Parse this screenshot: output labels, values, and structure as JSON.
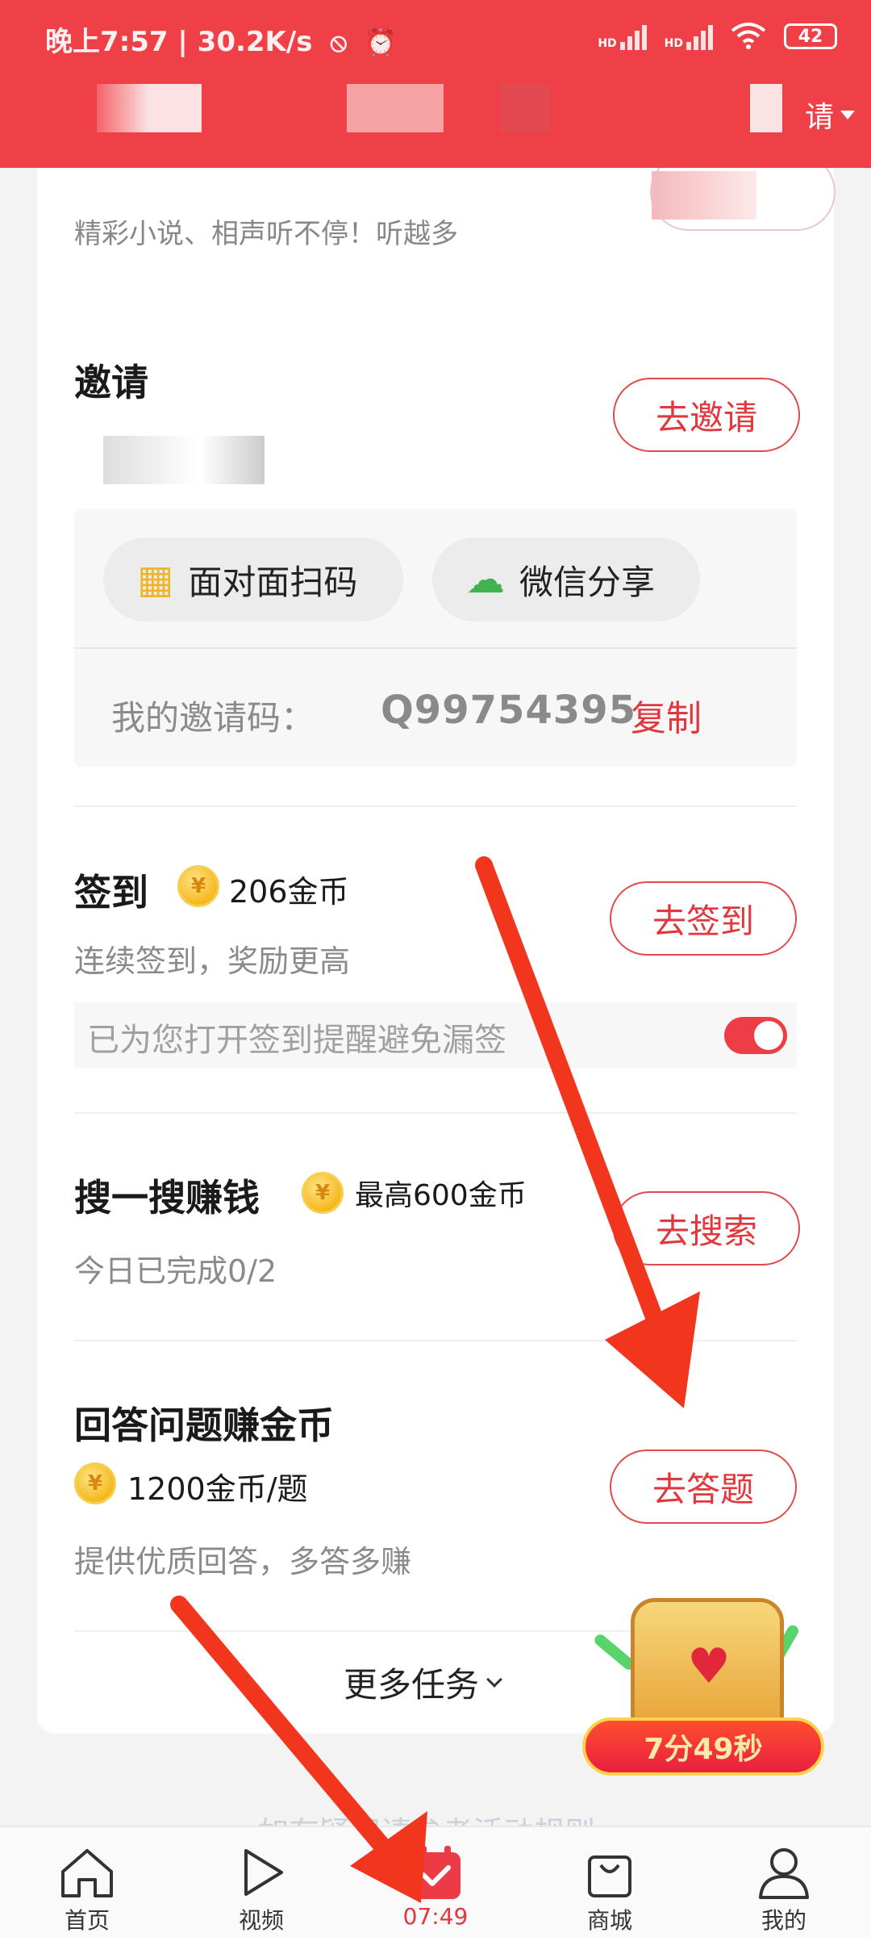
{
  "status_bar": {
    "left_text": "晚上7:57 | 30.2K/s",
    "signal_label_1": "HD",
    "signal_label_2": "HD",
    "battery": "42"
  },
  "header": {
    "right_label": "请"
  },
  "colors": {
    "brand_red": "#ef4048",
    "accent_red": "#e2373c",
    "gold": "#f6b81e"
  },
  "tasks": {
    "listen": {
      "subtitle": "精彩小说、相声听不停！听越多"
    },
    "invite": {
      "title": "邀请",
      "button": "去邀请",
      "face_scan_label": "面对面扫码",
      "wechat_share_label": "微信分享",
      "code_label": "我的邀请码：",
      "code_value": "Q99754395",
      "copy_label": "复制"
    },
    "checkin": {
      "title": "签到",
      "reward": "206金币",
      "subtitle": "连续签到，奖励更高",
      "button": "去签到",
      "reminder_text": "已为您打开签到提醒避免漏签",
      "reminder_on": true
    },
    "search": {
      "title": "搜一搜赚钱",
      "reward": "最高600金币",
      "subtitle": "今日已完成0/2",
      "button": "去搜索"
    },
    "answer": {
      "title": "回答问题赚金币",
      "reward": "1200金币/题",
      "subtitle": "提供优质回答，多答多赚",
      "button": "去答题"
    },
    "more_label": "更多任务"
  },
  "treasure": {
    "timer": "7分49秒"
  },
  "footer_note": "如有疑问请参考活动规则",
  "nav": {
    "items": [
      {
        "label": "首页",
        "icon": "home-icon"
      },
      {
        "label": "视频",
        "icon": "play-icon"
      },
      {
        "label": "07:49",
        "icon": "calendar-check-icon"
      },
      {
        "label": "商城",
        "icon": "shopping-bag-icon"
      },
      {
        "label": "我的",
        "icon": "user-icon"
      }
    ],
    "active_index": 2
  }
}
